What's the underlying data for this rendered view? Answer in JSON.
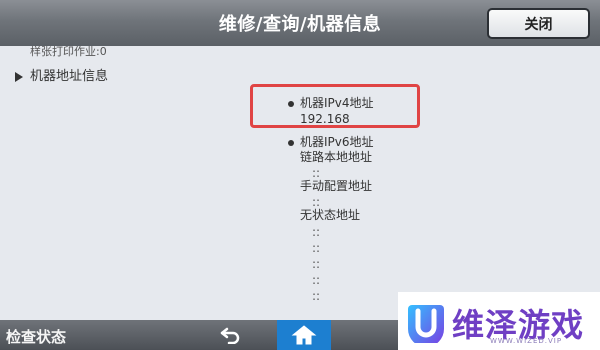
{
  "header": {
    "title": "维修/查询/机器信息",
    "close_label": "关闭"
  },
  "left_list": {
    "item_sample": "样张打印作业:0",
    "item_machine_address": "机器地址信息"
  },
  "ip_info": {
    "ipv4_label": "机器IPv4地址",
    "ipv4_value": "192.168",
    "ipv6_label": "机器IPv6地址",
    "link_local_label": "链路本地地址",
    "manual_label": "手动配置地址",
    "stateless_label": "无状态地址",
    "colon_mark": "::"
  },
  "footer": {
    "status_label": "检查状态"
  },
  "watermark_logo": {
    "text": "维泽游戏",
    "sub": "WWW.WIZED.VIP"
  },
  "icons": [
    "close-button",
    "back-arrow-icon",
    "home-icon",
    "triangle-right-icon",
    "bullet-icon",
    "logo-icon"
  ],
  "colors": {
    "highlight": "#e04444",
    "home_bg": "#1d7fd0",
    "brand": "#6f3fc4"
  }
}
